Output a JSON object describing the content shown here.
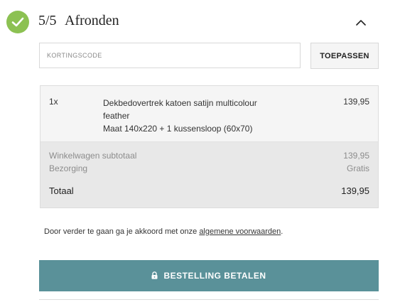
{
  "step": {
    "number": "5/5",
    "title": "Afronden",
    "status_icon": "check-circle-icon",
    "collapse_icon": "chevron-up-icon",
    "accent_color": "#8cc152"
  },
  "coupon": {
    "placeholder": "KORTINGSCODE",
    "value": "",
    "apply_label": "TOEPASSEN"
  },
  "order": {
    "items": [
      {
        "qty": "1x",
        "name_line1": "Dekbedovertrek katoen satijn multicolour",
        "name_line2": "feather",
        "variant": "Maat 140x220 + 1 kussensloop (60x70)",
        "price": "139,95"
      }
    ],
    "subtotal_label": "Winkelwagen subtotaal",
    "subtotal_value": "139,95",
    "shipping_label": "Bezorging",
    "shipping_value": "Gratis",
    "total_label": "Totaal",
    "total_value": "139,95"
  },
  "terms": {
    "text": "Door verder te gaan ga je akkoord met onze",
    "link_text": "algemene voorwaarden",
    "suffix": "."
  },
  "pay": {
    "label": "BESTELLING BETALEN",
    "icon": "lock-icon",
    "color": "#5a9199"
  }
}
